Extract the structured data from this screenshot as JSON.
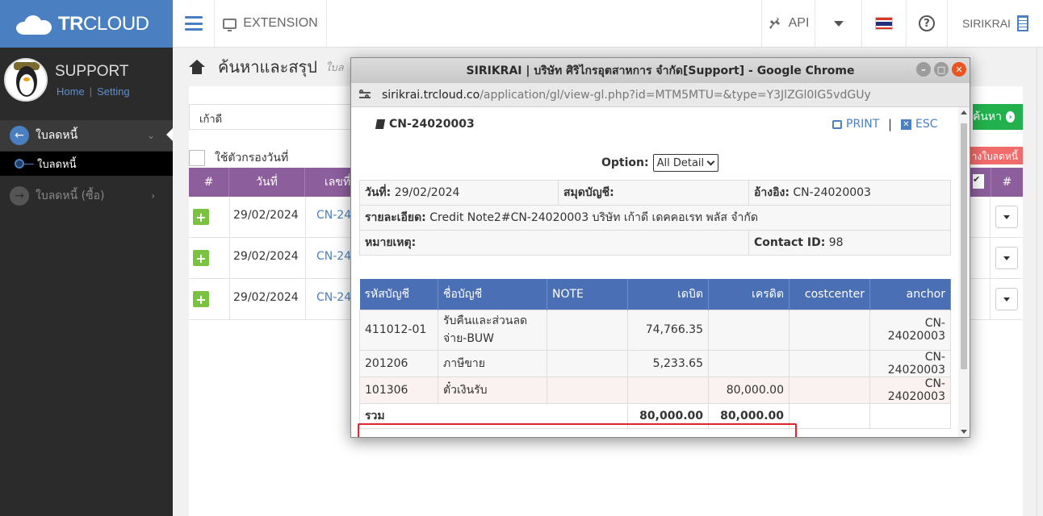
{
  "brand": {
    "logo_bold": "TR",
    "logo_light": "CLOUD"
  },
  "topbar": {
    "extension_label": "EXTENSION",
    "api_label": "API",
    "user_label": "SIRIKRAI",
    "help_glyph": "?"
  },
  "sidebar": {
    "profile_name": "SUPPORT",
    "home_link": "Home",
    "link_separator": "|",
    "setting_link": "Setting",
    "menu_main": "ใบลดหนี้",
    "submenu": "ใบลดหนี้",
    "menu_alt": "ใบลดหนี้ (ซื้อ)"
  },
  "main": {
    "page_title": "ค้นหาและสรุป",
    "page_sub": "ใบล",
    "search_value": "เก้าดี",
    "search_button": "ค้นหา",
    "date_filter_label": "ใช้ตัวกรองวันที่",
    "red_tag": "างใบลดหนี้",
    "grid_headers": {
      "hash": "#",
      "date": "วันที่",
      "doc_no": "เลขที่",
      "hash_right": "#"
    },
    "rows": [
      {
        "date": "29/02/2024",
        "doc": "CN-24"
      },
      {
        "date": "29/02/2024",
        "doc": "CN-24"
      },
      {
        "date": "29/02/2024",
        "doc": "CN-24"
      }
    ]
  },
  "popup": {
    "window_title": "SIRIKRAI | บริษัท ศิริไกรอุตสาหการ จำกัด[Support] - Google Chrome",
    "url_host": "sirikrai.trcloud.co",
    "url_rest": "/application/gl/view-gl.php?id=MTM5MTU=&type=Y3JlZGl0IG5vdGUy",
    "doc_no": "CN-24020003",
    "print_label": "PRINT",
    "pipe": "|",
    "esc_label": "ESC",
    "option_label": "Option:",
    "option_value": "All Detail",
    "info": {
      "date_label": "วันที่:",
      "date_value": "29/02/2024",
      "book_label": "สมุดบัญชี:",
      "book_value": "",
      "ref_label": "อ้างอิง:",
      "ref_value": "CN-24020003",
      "detail_label": "รายละเอียด:",
      "detail_value": "Credit Note2#CN-24020003 บริษัท เก้าดี เดคคอเรท พลัส จำกัด",
      "remark_label": "หมายเหตุ:",
      "remark_value": "",
      "contact_label": "Contact ID:",
      "contact_value": "98"
    },
    "gl_headers": {
      "code": "รหัสบัญชี",
      "name": "ชื่อบัญชี",
      "note": "NOTE",
      "debit": "เดบิต",
      "credit": "เครดิต",
      "costcenter": "costcenter",
      "anchor": "anchor"
    },
    "gl_rows": [
      {
        "code": "411012-01",
        "name": "รับคืนและส่วนลดจ่าย-BUW",
        "note": "",
        "debit": "74,766.35",
        "credit": "",
        "costcenter": "",
        "anchor": "CN-24020003"
      },
      {
        "code": "201206",
        "name": "ภาษีขาย",
        "note": "",
        "debit": "5,233.65",
        "credit": "",
        "costcenter": "",
        "anchor": "CN-24020003"
      },
      {
        "code": "101306",
        "name": "ตั๋วเงินรับ",
        "note": "",
        "debit": "",
        "credit": "80,000.00",
        "costcenter": "",
        "anchor": "CN-24020003"
      }
    ],
    "gl_total": {
      "label": "รวม",
      "debit": "80,000.00",
      "credit": "80,000.00"
    }
  },
  "colors": {
    "brand_blue": "#4a7fc1",
    "grid_header_purple": "#8c5e9c",
    "gl_header_blue": "#4a6fb4",
    "search_green": "#22b14c",
    "highlight_red": "#e0242c"
  }
}
